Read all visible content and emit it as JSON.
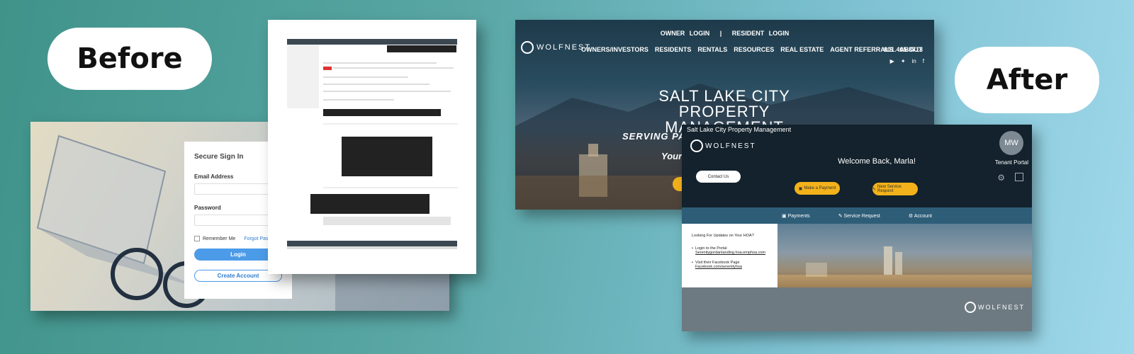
{
  "labels": {
    "before": "Before",
    "after": "After"
  },
  "signin": {
    "title": "Secure Sign In",
    "email_label": "Email Address",
    "password_label": "Password",
    "remember_label": "Remember Me",
    "forgot_label": "Forgot Pass",
    "login_button": "Login",
    "create_button": "Create Account"
  },
  "hero": {
    "top_links": [
      "OWNER LOGIN",
      "|",
      "RESIDENT LOGIN"
    ],
    "brand": "WOLFNEST",
    "nav": [
      "OWNERS/INVESTORS",
      "RESIDENTS",
      "RENTALS",
      "RESOURCES",
      "REAL ESTATE",
      "AGENT REFERRALS",
      "ABOUT"
    ],
    "phone": "801.405.3713",
    "headline1": "SALT LAKE CITY",
    "headline2": "PROPERTY MANAGEMENT",
    "subhead": "SERVING PAR",
    "your": "Your"
  },
  "portal": {
    "header": "Salt Lake City Property Management",
    "brand": "WOLFNEST",
    "avatar": "MW",
    "role": "Tenant Portal",
    "welcome": "Welcome Back, Marla!",
    "contact_button": "Contact Us",
    "make_payment": "Make a Payment",
    "new_service": "New Service Request",
    "tabs": [
      "Payments",
      "Service Request",
      "Account"
    ],
    "hoa_title": "Looking For Updates on Your HOA?",
    "bullet1_label": "Login to the Portal",
    "bullet1_link": "Serenitygordanlanding.hoa.emphoa.com",
    "bullet2_label": "Visit their Facebook Page",
    "bullet2_link": "Facebook.com/serenityhoa",
    "footer_brand": "WOLFNEST"
  },
  "colors": {
    "accent_gold": "#f3b21b",
    "portal_dark": "#13222c",
    "tab_bar": "#2e5d78",
    "login_blue": "#4c9be8"
  }
}
